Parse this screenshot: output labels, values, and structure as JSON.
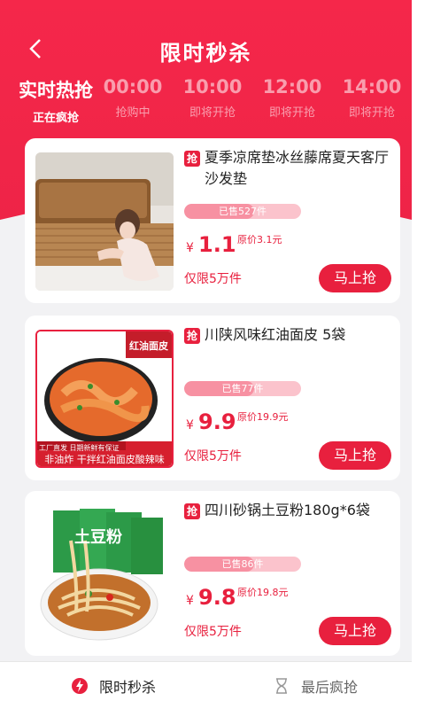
{
  "header": {
    "title": "限时秒杀",
    "back_icon": "chevron-left-icon"
  },
  "tabs": [
    {
      "time": "实时热抢",
      "state": "正在疯抢",
      "active": true
    },
    {
      "time": "00:00",
      "state": "抢购中",
      "active": false
    },
    {
      "time": "10:00",
      "state": "即将开抢",
      "active": false
    },
    {
      "time": "12:00",
      "state": "即将开抢",
      "active": false
    },
    {
      "time": "14:00",
      "state": "即将开抢",
      "active": false
    }
  ],
  "items": [
    {
      "badge": "抢",
      "name": "夏季凉席垫冰丝藤席夏天客厅沙发垫",
      "sold": "已售527件",
      "price_symbol": "¥",
      "price": "1.1",
      "original": "原价3.1元",
      "limit": "仅限5万件",
      "button": "马上抢"
    },
    {
      "badge": "抢",
      "name": "川陕风味红油面皮 5袋",
      "sold": "已售77件",
      "price_symbol": "¥",
      "price": "9.9",
      "original": "原价19.9元",
      "limit": "仅限5万件",
      "button": "马上抢",
      "img_tag": "红油面皮",
      "img_caption_small": "工厂直发 日期新鲜有保证",
      "img_caption": "非油炸 干拌红油面皮酸辣味"
    },
    {
      "badge": "抢",
      "name": "四川砂锅土豆粉180g*6袋",
      "sold": "已售86件",
      "price_symbol": "¥",
      "price": "9.8",
      "original": "原价19.8元",
      "limit": "仅限5万件",
      "button": "马上抢",
      "img_tag": "土豆粉"
    }
  ],
  "bottom_nav": [
    {
      "label": "限时秒杀",
      "icon": "lightning-icon"
    },
    {
      "label": "最后疯抢",
      "icon": "hourglass-icon"
    }
  ],
  "colors": {
    "brand_red": "#e8203e",
    "hero_red": "#f5274a"
  }
}
